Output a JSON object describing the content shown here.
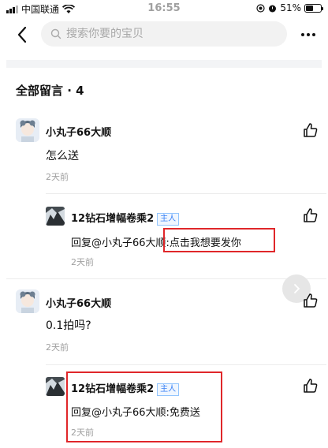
{
  "status_bar": {
    "carrier": "中国联通",
    "time": "16:55",
    "battery": "51%",
    "battery_level": 0.51
  },
  "nav": {
    "back_icon": "chevron-left-icon",
    "search_placeholder": "搜索你要的宝贝",
    "more_icon": "more-dots-icon"
  },
  "section": {
    "title": "全部留言 · 4"
  },
  "comments": [
    {
      "author": "小丸子66大顺",
      "text": "怎么送",
      "time": "2天前",
      "replies": [
        {
          "author": "12钻石增幅卷乘2",
          "badge": "主人",
          "text": "回复@小丸子66大顺:点击我想要发你",
          "time": "2天前"
        }
      ]
    },
    {
      "author": "小丸子66大顺",
      "text": "0.1拍吗?",
      "time": "2天前",
      "replies": [
        {
          "author": "12钻石增幅卷乘2",
          "badge": "主人",
          "text": "回复@小丸子66大顺:免费送",
          "time": "2天前"
        }
      ]
    }
  ],
  "colors": {
    "highlight_box": "#e0272a",
    "badge_text": "#3b82f6",
    "muted": "#a0a0a0"
  }
}
